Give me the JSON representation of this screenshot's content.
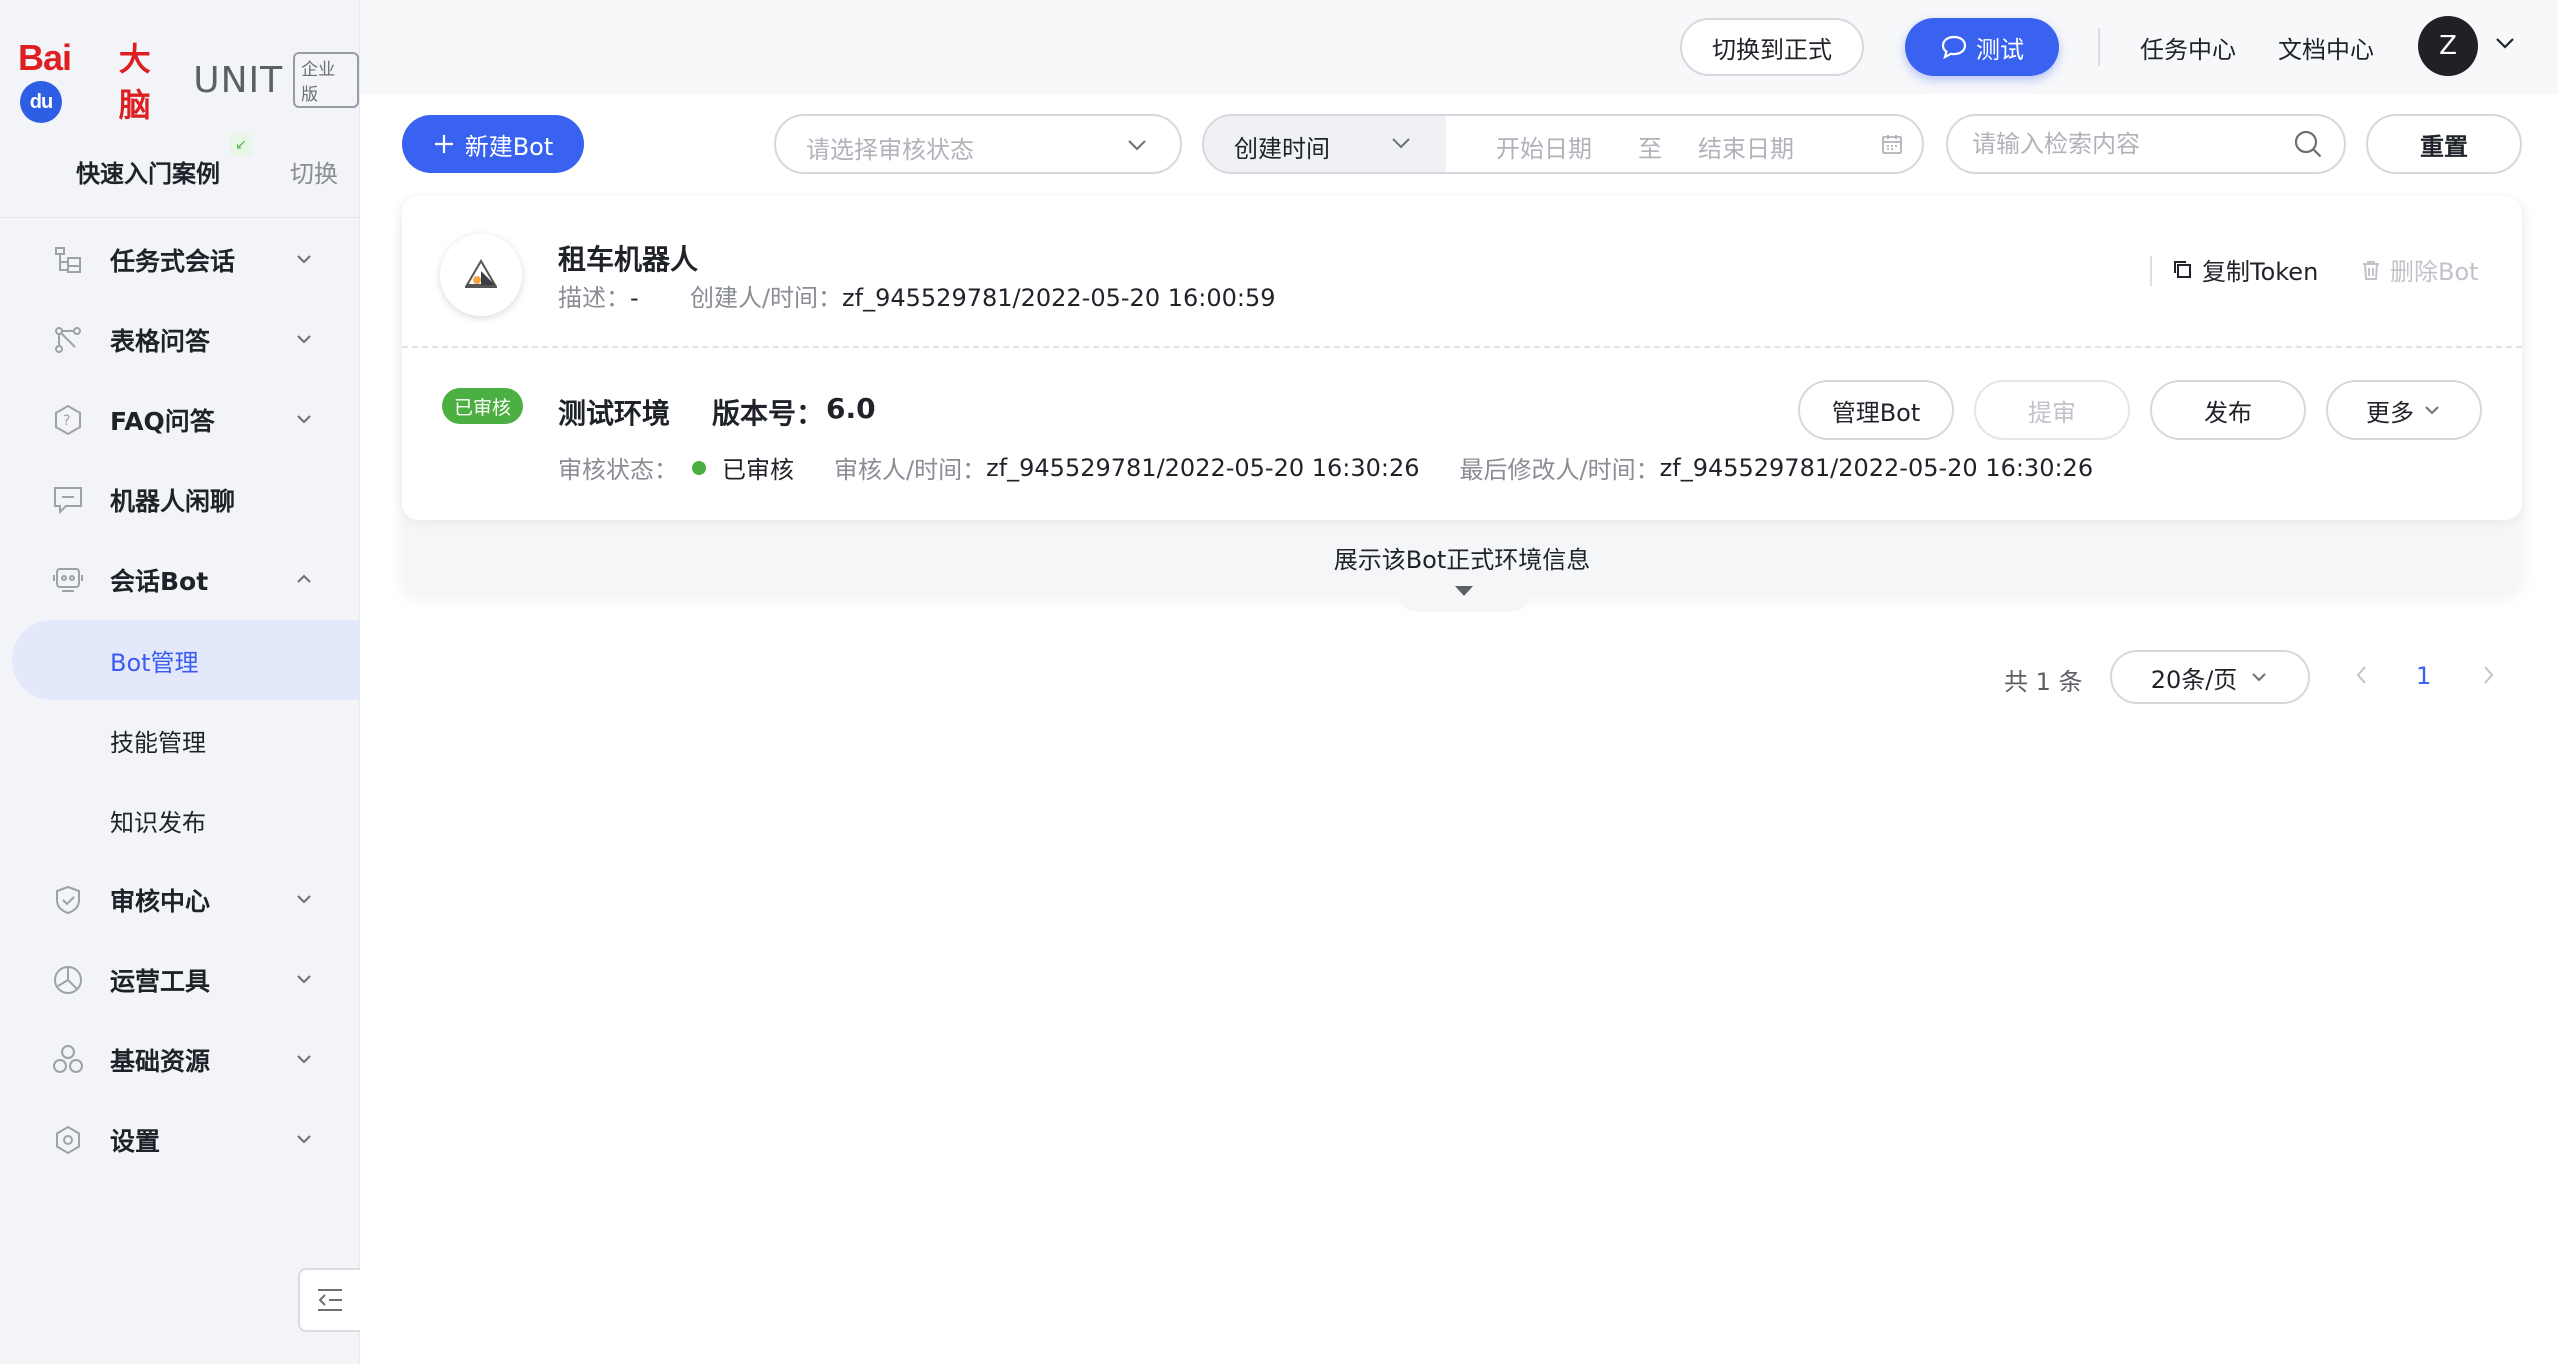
{
  "sidebar": {
    "logo": {
      "brand": "Bai",
      "brand_paw": "du",
      "dano": "大脑",
      "product": "UNIT",
      "edition": "企业版"
    },
    "quick_case": "快速入门案例",
    "quick_switch": "切换",
    "menu": [
      {
        "label": "任务式会话",
        "icon": "task-dialog-icon"
      },
      {
        "label": "表格问答",
        "icon": "table-qa-icon"
      },
      {
        "label": "FAQ问答",
        "icon": "faq-icon"
      },
      {
        "label": "机器人闲聊",
        "icon": "chat-icon"
      },
      {
        "label": "会话Bot",
        "icon": "bot-icon"
      }
    ],
    "bot_sub": [
      {
        "label": "Bot管理",
        "active": true
      },
      {
        "label": "技能管理"
      },
      {
        "label": "知识发布"
      }
    ],
    "menu2": [
      {
        "label": "审核中心",
        "icon": "shield-check-icon"
      },
      {
        "label": "运营工具",
        "icon": "ops-tool-icon"
      },
      {
        "label": "基础资源",
        "icon": "resource-icon"
      },
      {
        "label": "设置",
        "icon": "gear-icon"
      }
    ]
  },
  "topbar": {
    "switch_prod": "切换到正式",
    "test": "测试",
    "task_center": "任务中心",
    "doc_center": "文档中心",
    "avatar_letter": "Z"
  },
  "filters": {
    "new_bot": "新建Bot",
    "status_placeholder": "请选择审核状态",
    "date_type": "创建时间",
    "start_date": "开始日期",
    "to": "至",
    "end_date": "结束日期",
    "search_placeholder": "请输入检索内容",
    "reset": "重置"
  },
  "bot": {
    "name": "租车机器人",
    "desc_label": "描述：",
    "desc": "-",
    "creator_label": "创建人/时间：",
    "creator": "zf_945529781/2022-05-20 16:00:59",
    "copy_token": "复制Token",
    "delete_bot": "删除Bot",
    "env": {
      "badge": "已审核",
      "name": "测试环境",
      "version_label": "版本号：",
      "version": "6.0",
      "status_label": "审核状态：",
      "status": "已审核",
      "reviewer_label": "审核人/时间：",
      "reviewer": "zf_945529781/2022-05-20 16:30:26",
      "modifier_label": "最后修改人/时间：",
      "modifier": "zf_945529781/2022-05-20 16:30:26",
      "status_color": "#4caf41"
    },
    "actions": {
      "manage": "管理Bot",
      "submit": "提审",
      "publish": "发布",
      "more": "更多"
    },
    "expand_text": "展示该Bot正式环境信息"
  },
  "pagination": {
    "total": "共 1 条",
    "page_size": "20条/页",
    "current": "1"
  },
  "colors": {
    "primary": "#3a62f0",
    "success": "#4caf41",
    "brand_red": "#de1f22"
  }
}
